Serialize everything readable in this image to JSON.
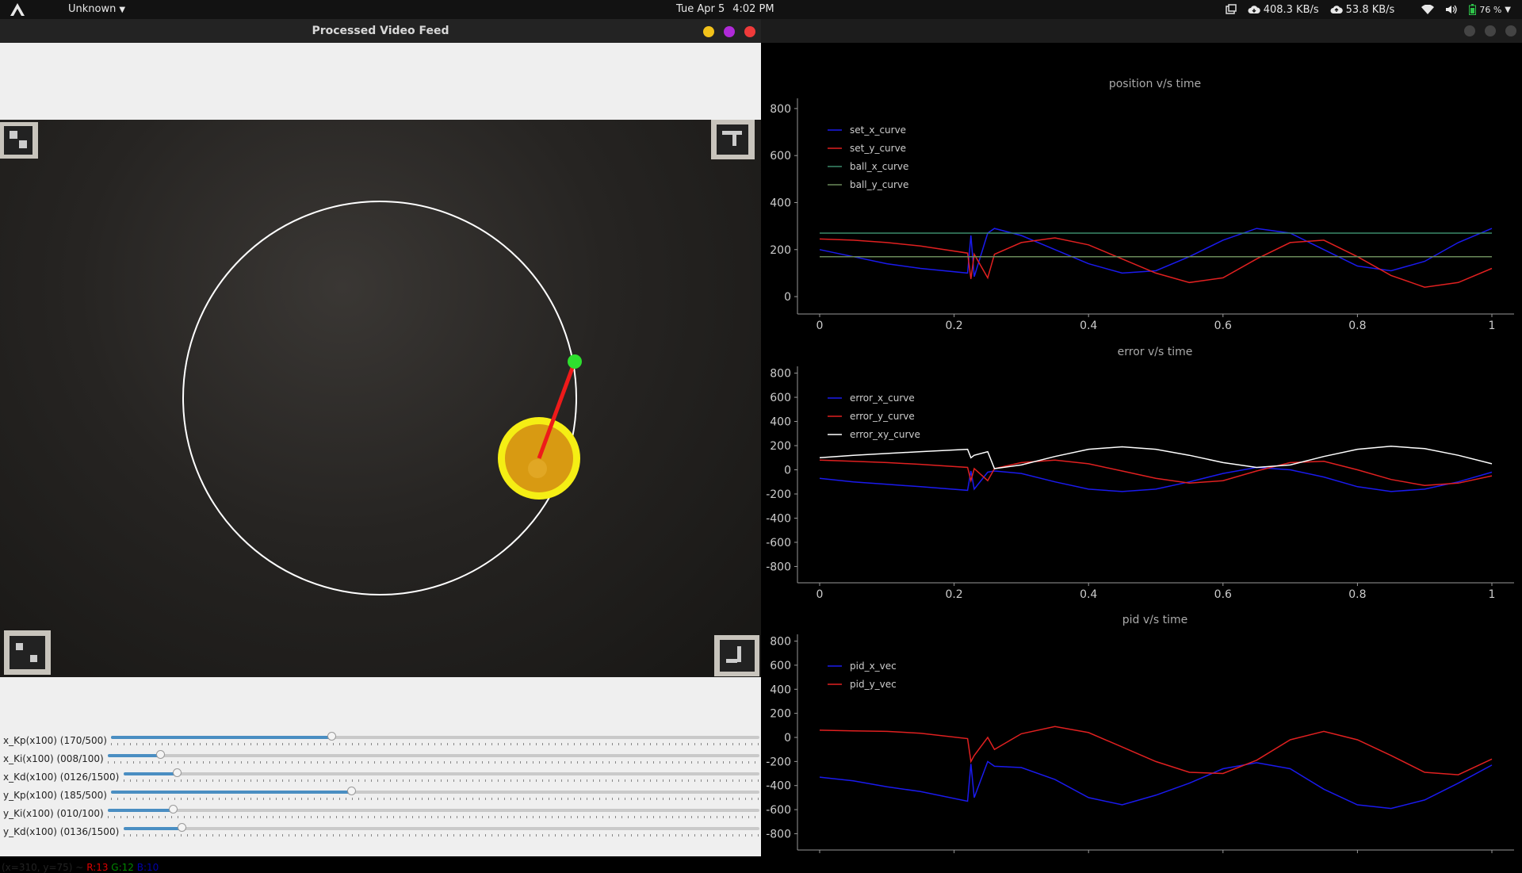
{
  "topbar": {
    "app_name": "Unknown",
    "date": "Tue Apr 5",
    "time": "4:02 PM",
    "down_speed": "408.3 KB/s",
    "up_speed": "53.8 KB/s",
    "battery": "76 %"
  },
  "video_window": {
    "title": "Processed Video Feed",
    "sliders": [
      {
        "label": "x_Kp(x100) (170/500)",
        "value": 170,
        "max": 500
      },
      {
        "label": "x_Ki(x100) (008/100)",
        "value": 8,
        "max": 100
      },
      {
        "label": "x_Kd(x100) (0126/1500)",
        "value": 126,
        "max": 1500
      },
      {
        "label": "y_Kp(x100) (185/500)",
        "value": 185,
        "max": 500
      },
      {
        "label": "y_Ki(x100) (010/100)",
        "value": 10,
        "max": 100
      },
      {
        "label": "y_Kd(x100) (0136/1500)",
        "value": 136,
        "max": 1500
      }
    ],
    "status": {
      "coords": "(x=310, y=75) ~",
      "r": "R:13",
      "g": "G:12",
      "b": "B:10"
    }
  },
  "colors": {
    "red": "#e02020",
    "blue": "#1a1aee",
    "green": "#3a8a6a",
    "white": "#ffffff",
    "accent": "#4a8ec2"
  },
  "chart_data": [
    {
      "type": "line",
      "title": "position v/s time",
      "ylim": [
        -20,
        830
      ],
      "xlim": [
        0,
        1
      ],
      "yticks": [
        0,
        200,
        400,
        600,
        800
      ],
      "xticks": [
        0,
        0.2,
        0.4,
        0.6,
        0.8,
        1
      ],
      "xtick_labels": [
        "0",
        "0.2",
        "0.4",
        "0.6",
        "0.8",
        "1"
      ],
      "legend": "top-left",
      "series": [
        {
          "name": "set_x_curve",
          "color": "#1a1aee",
          "x": [
            0,
            0.05,
            0.1,
            0.15,
            0.22,
            0.225,
            0.23,
            0.25,
            0.26,
            0.3,
            0.35,
            0.4,
            0.45,
            0.5,
            0.55,
            0.6,
            0.65,
            0.7,
            0.75,
            0.8,
            0.85,
            0.9,
            0.95,
            1
          ],
          "y": [
            200,
            170,
            140,
            120,
            100,
            260,
            85,
            270,
            290,
            260,
            200,
            140,
            100,
            110,
            170,
            240,
            290,
            270,
            200,
            130,
            110,
            150,
            230,
            290
          ]
        },
        {
          "name": "set_y_curve",
          "color": "#e02020",
          "x": [
            0,
            0.05,
            0.1,
            0.15,
            0.22,
            0.225,
            0.23,
            0.25,
            0.26,
            0.3,
            0.35,
            0.4,
            0.45,
            0.5,
            0.55,
            0.6,
            0.65,
            0.7,
            0.75,
            0.8,
            0.85,
            0.9,
            0.95,
            1
          ],
          "y": [
            245,
            240,
            230,
            215,
            185,
            75,
            180,
            80,
            180,
            230,
            250,
            220,
            160,
            100,
            60,
            80,
            160,
            230,
            240,
            170,
            90,
            40,
            60,
            120
          ]
        },
        {
          "name": "ball_x_curve",
          "color": "#3a8a6a",
          "x": [
            0,
            1
          ],
          "y": [
            270,
            270
          ]
        },
        {
          "name": "ball_y_curve",
          "color": "#6a8a5a",
          "x": [
            0,
            1
          ],
          "y": [
            170,
            170
          ]
        }
      ]
    },
    {
      "type": "line",
      "title": "error v/s time",
      "ylim": [
        -830,
        830
      ],
      "xlim": [
        0,
        1
      ],
      "yticks": [
        -800,
        -600,
        -400,
        -200,
        0,
        200,
        400,
        600,
        800
      ],
      "xticks": [
        0,
        0.2,
        0.4,
        0.6,
        0.8,
        1
      ],
      "xtick_labels": [
        "0",
        "0.2",
        "0.4",
        "0.6",
        "0.8",
        "1"
      ],
      "legend": "top-left",
      "series": [
        {
          "name": "error_x_curve",
          "color": "#1a1aee",
          "x": [
            0,
            0.05,
            0.1,
            0.15,
            0.22,
            0.225,
            0.23,
            0.25,
            0.26,
            0.3,
            0.35,
            0.4,
            0.45,
            0.5,
            0.55,
            0.6,
            0.65,
            0.7,
            0.75,
            0.8,
            0.85,
            0.9,
            0.95,
            1
          ],
          "y": [
            -70,
            -100,
            -120,
            -140,
            -170,
            -10,
            -160,
            -20,
            -10,
            -30,
            -100,
            -160,
            -180,
            -160,
            -100,
            -30,
            20,
            0,
            -60,
            -140,
            -180,
            -160,
            -100,
            -20
          ]
        },
        {
          "name": "error_y_curve",
          "color": "#e02020",
          "x": [
            0,
            0.05,
            0.1,
            0.15,
            0.22,
            0.225,
            0.23,
            0.25,
            0.26,
            0.3,
            0.35,
            0.4,
            0.45,
            0.5,
            0.55,
            0.6,
            0.65,
            0.7,
            0.75,
            0.8,
            0.85,
            0.9,
            0.95,
            1
          ],
          "y": [
            80,
            70,
            60,
            45,
            20,
            -90,
            10,
            -90,
            10,
            60,
            80,
            50,
            -10,
            -70,
            -110,
            -90,
            -10,
            60,
            70,
            0,
            -80,
            -130,
            -110,
            -50
          ]
        },
        {
          "name": "error_xy_curve",
          "color": "#ffffff",
          "x": [
            0,
            0.05,
            0.1,
            0.15,
            0.22,
            0.225,
            0.23,
            0.25,
            0.26,
            0.3,
            0.35,
            0.4,
            0.45,
            0.5,
            0.55,
            0.6,
            0.65,
            0.7,
            0.75,
            0.8,
            0.85,
            0.9,
            0.95,
            1
          ],
          "y": [
            100,
            120,
            135,
            150,
            170,
            100,
            120,
            150,
            10,
            40,
            110,
            170,
            190,
            170,
            120,
            60,
            20,
            40,
            110,
            170,
            195,
            175,
            120,
            50
          ]
        }
      ]
    },
    {
      "type": "line",
      "title": "pid v/s time",
      "ylim": [
        -830,
        830
      ],
      "xlim": [
        0,
        1
      ],
      "yticks": [
        -800,
        -600,
        -400,
        -200,
        0,
        200,
        400,
        600,
        800
      ],
      "xticks": [
        0,
        0.2,
        0.4,
        0.6,
        0.8,
        1
      ],
      "xtick_labels": [
        "0",
        "0.2",
        "0.4",
        "0.6",
        "0.8",
        "1"
      ],
      "legend": "top-left",
      "series": [
        {
          "name": "pid_x_vec",
          "color": "#1a1aee",
          "x": [
            0,
            0.05,
            0.1,
            0.15,
            0.22,
            0.225,
            0.23,
            0.25,
            0.26,
            0.3,
            0.35,
            0.4,
            0.45,
            0.5,
            0.55,
            0.6,
            0.65,
            0.7,
            0.75,
            0.8,
            0.85,
            0.9,
            0.95,
            1
          ],
          "y": [
            -330,
            -360,
            -410,
            -450,
            -530,
            -220,
            -500,
            -200,
            -240,
            -250,
            -350,
            -500,
            -560,
            -480,
            -380,
            -260,
            -210,
            -260,
            -430,
            -560,
            -590,
            -520,
            -380,
            -230
          ]
        },
        {
          "name": "pid_y_vec",
          "color": "#e02020",
          "x": [
            0,
            0.05,
            0.1,
            0.15,
            0.22,
            0.225,
            0.23,
            0.25,
            0.26,
            0.3,
            0.35,
            0.4,
            0.45,
            0.5,
            0.55,
            0.6,
            0.65,
            0.7,
            0.75,
            0.8,
            0.85,
            0.9,
            0.95,
            1
          ],
          "y": [
            60,
            55,
            50,
            35,
            -10,
            -200,
            -150,
            0,
            -100,
            30,
            90,
            40,
            -80,
            -200,
            -290,
            -300,
            -190,
            -20,
            50,
            -20,
            -150,
            -290,
            -310,
            -180
          ]
        }
      ]
    }
  ]
}
